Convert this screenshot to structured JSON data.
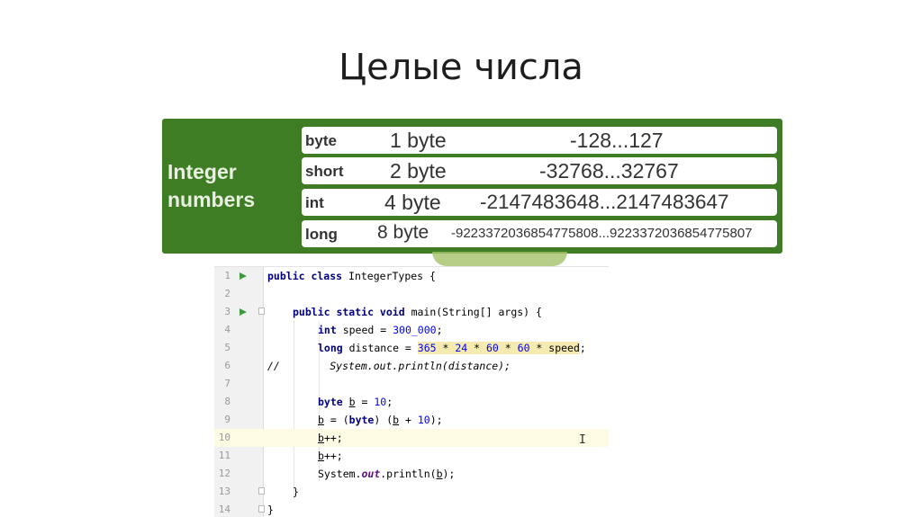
{
  "slide": {
    "title": "Целые числа"
  },
  "type_table": {
    "heading_line1": "Integer",
    "heading_line2": "numbers",
    "rows": [
      {
        "name": "byte",
        "size": "1 byte",
        "range": "-128...127"
      },
      {
        "name": "short",
        "size": "2 byte",
        "range": "-32768...32767"
      },
      {
        "name": "int",
        "size": "4 byte",
        "range": "-2147483648...2147483647"
      },
      {
        "name": "long",
        "size": "8 byte",
        "range": "-9223372036854775808...9223372036854775807"
      }
    ]
  },
  "editor": {
    "lines": [
      {
        "n": "1",
        "text": "public class IntegerTypes {"
      },
      {
        "n": "2",
        "text": ""
      },
      {
        "n": "3",
        "text": "public static void main(String[] args) {"
      },
      {
        "n": "4",
        "text": "int speed = 300_000;"
      },
      {
        "n": "5",
        "text": "long distance = 365 * 24 * 60 * 60 * speed;"
      },
      {
        "n": "6",
        "text": "//        System.out.println(distance);"
      },
      {
        "n": "7",
        "text": ""
      },
      {
        "n": "8",
        "text": "byte b = 10;"
      },
      {
        "n": "9",
        "text": "b = (byte) (b + 10);"
      },
      {
        "n": "10",
        "text": "b++;"
      },
      {
        "n": "11",
        "text": "b++;"
      },
      {
        "n": "12",
        "text": "System.out.println(b);"
      },
      {
        "n": "13",
        "text": "}"
      },
      {
        "n": "14",
        "text": "}"
      }
    ],
    "current_line": "10",
    "colors": {
      "keyword": "#000080",
      "number": "#0000ff",
      "comment": "#808080",
      "field": "#660e7a",
      "highlight": "#f5eab0",
      "run": "#3d9a3d"
    }
  }
}
